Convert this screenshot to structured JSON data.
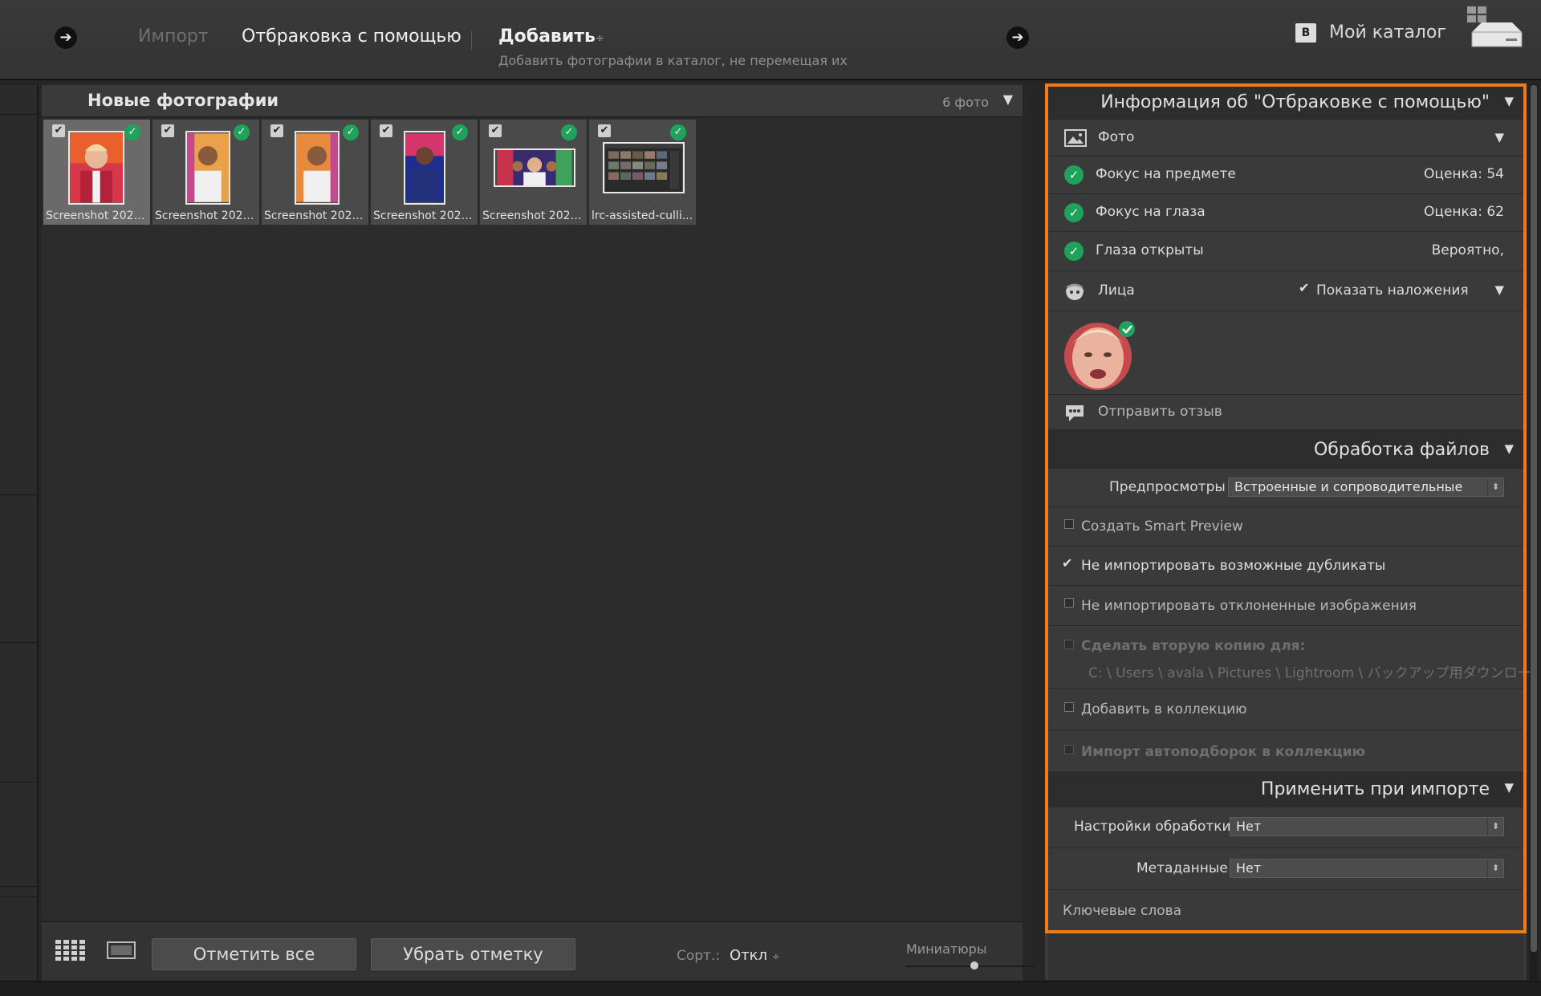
{
  "topbar": {
    "import_label": "Импорт",
    "culling_label": "Отбраковка с помощью",
    "add_label": "Добавить",
    "add_caret": "÷",
    "add_subtitle": "Добавить фотографии в каталог, не перемещая их",
    "catalog_badge": "B",
    "catalog_label": "Мой каталог"
  },
  "grid": {
    "title": "Новые фотографии",
    "count": "6 фото",
    "thumbnails": [
      {
        "name": "Screenshot 2026...",
        "checked": true,
        "selected": true
      },
      {
        "name": "Screenshot 2026...",
        "checked": true,
        "selected": false
      },
      {
        "name": "Screenshot 2026...",
        "checked": true,
        "selected": false
      },
      {
        "name": "Screenshot 2026...",
        "checked": true,
        "selected": false
      },
      {
        "name": "Screenshot 2026...",
        "checked": true,
        "selected": false
      },
      {
        "name": "lrc-assisted-culli...",
        "checked": true,
        "selected": false
      }
    ]
  },
  "toolbar": {
    "check_all": "Отметить все",
    "uncheck_all": "Убрать отметку",
    "sort_label": "Сорт.:",
    "sort_value": "Откл",
    "sort_caret": "÷",
    "thumbnails_label": "Миниатюры"
  },
  "panel": {
    "info_header": "Информация об \"Отбраковке с помощью\"",
    "photo_label": "Фото",
    "focus_subject": {
      "label": "Фокус на предмете",
      "value": "Оценка: 54"
    },
    "focus_eyes": {
      "label": "Фокус на глаза",
      "value": "Оценка: 62"
    },
    "eyes_open": {
      "label": "Глаза открыты",
      "value": "Вероятно,"
    },
    "faces_label": "Лица",
    "show_overlays": "Показать наложения",
    "feedback": "Отправить отзыв",
    "file_handling_header": "Обработка файлов",
    "previews_label": "Предпросмотры",
    "previews_value": "Встроенные и сопроводительные",
    "smart_preview": "Создать Smart Preview",
    "no_duplicates": "Не импортировать возможные дубликаты",
    "no_rejected": "Не импортировать отклоненные изображения",
    "second_copy": "Сделать вторую копию для:",
    "second_copy_path": "C: \\ Users \\ avala \\ Pictures \\ Lightroom \\ バックアップ用ダウンロー",
    "add_collection": "Добавить в коллекцию",
    "import_auto_collection": "Импорт автоподборок в коллекцию",
    "apply_header": "Применить при импорте",
    "develop_label": "Настройки обработки",
    "develop_value": "Нет",
    "metadata_label": "Метаданные",
    "metadata_value": "Нет",
    "keywords_label": "Ключевые слова"
  },
  "colors": {
    "accent_highlight": "#f07b1a",
    "ok_green": "#1fa35b"
  }
}
